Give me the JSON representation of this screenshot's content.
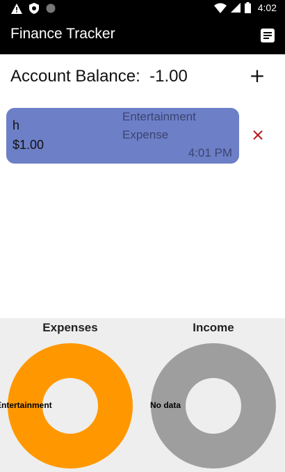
{
  "status_bar": {
    "time": "4:02",
    "left_icons": [
      "warning-icon",
      "shield-icon",
      "circle-icon"
    ],
    "right_icons": [
      "wifi-icon",
      "cell-signal-icon",
      "battery-icon"
    ]
  },
  "app_bar": {
    "title": "Finance Tracker",
    "menu_icon": "list-icon"
  },
  "balance": {
    "label": "Account Balance:",
    "value": "-1.00",
    "add_label": "+"
  },
  "transactions": [
    {
      "name": "h",
      "amount": "$1.00",
      "category": "Entertainment",
      "type": "Expense",
      "time": "4:01 PM",
      "color": "#6d7fc7"
    }
  ],
  "charts": {
    "expenses": {
      "title": "Expenses",
      "label": "Entertainment",
      "color": "#ff9800"
    },
    "income": {
      "title": "Income",
      "label": "No data",
      "color": "#9e9e9e"
    }
  },
  "chart_data": [
    {
      "type": "pie",
      "title": "Expenses",
      "categories": [
        "Entertainment"
      ],
      "values": [
        1.0
      ],
      "colors": [
        "#ff9800"
      ],
      "donut": true
    },
    {
      "type": "pie",
      "title": "Income",
      "categories": [
        "No data"
      ],
      "values": [
        1
      ],
      "colors": [
        "#9e9e9e"
      ],
      "donut": true
    }
  ]
}
